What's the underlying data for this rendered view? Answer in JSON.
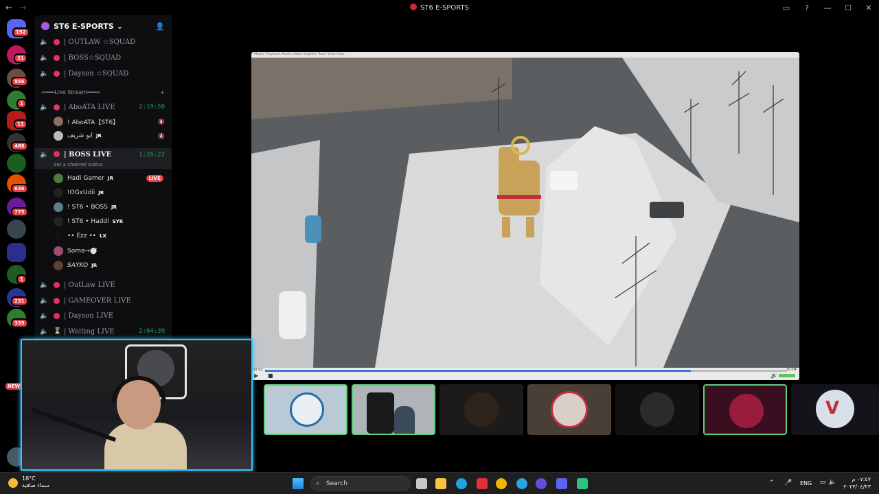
{
  "window": {
    "title": "ST6 E-SPORTS",
    "min": "—",
    "max": "☐",
    "close": "✕",
    "help": "?",
    "inbox": "▭"
  },
  "rail": {
    "badges": [
      "192",
      "31",
      "956",
      "1",
      "11",
      "488",
      "636",
      "775",
      "1",
      "231",
      "339",
      "NEW"
    ]
  },
  "server": {
    "name": "ST6 E-SPORTS"
  },
  "channels_top": [
    {
      "name": "| OUTLAW ☆SQUAD"
    },
    {
      "name": "| BOSS☆SQUAD"
    },
    {
      "name": "| Dayson ☆SQUAD"
    }
  ],
  "category": {
    "name": "«━━━Live Stream━━━»",
    "add": "+"
  },
  "live_channels": [
    {
      "name": "| AboATA LIVE",
      "time": "2:19:50"
    },
    {
      "name": "| BOSS LIVE",
      "time": "1:26:22",
      "status": "Set a channel status"
    },
    {
      "name": "| OutLaw LIVE",
      "time": ""
    },
    {
      "name": "| GAMEOVER LIVE",
      "time": ""
    },
    {
      "name": "| Dayson LIVE",
      "time": ""
    },
    {
      "name": "| Waiting LIVE",
      "time": "2:04:39"
    }
  ],
  "users_aboata": [
    {
      "name": "! AboATA【ST6】",
      "tag": ""
    },
    {
      "name": "ابو شريف",
      "tag": "JR"
    }
  ],
  "users_boss": [
    {
      "name": "Hadi Gamer",
      "tag": "JR",
      "live": "LIVE"
    },
    {
      "name": "!OGxUdii",
      "tag": "JR"
    },
    {
      "name": "! ST6 • BOSS",
      "tag": "JR"
    },
    {
      "name": "! ST6 • Haddi",
      "tag": "SYR"
    },
    {
      "name": "•• Ezz ••",
      "tag": "LX"
    },
    {
      "name": "Soma→⬤⃗",
      "tag": ""
    },
    {
      "name": "SAYKO",
      "tag": "JR"
    }
  ],
  "vlc": {
    "menu": "Media  Playback  Audio  Video  Subtitle  Tools  View  Help",
    "elapsed": "00:53",
    "total": "01:04"
  },
  "taskbar": {
    "temp": "18°C",
    "weather": "سماء صافية",
    "search": "Search",
    "lang": "ENG",
    "time": "٠٧:٤٧ م",
    "date": "٢٠٢٣/٠٤/٢٣"
  },
  "colors": {
    "accent": "#35c3ff",
    "live": "#ed4245",
    "speaking": "#23a55a",
    "badge": "#e53d44"
  }
}
